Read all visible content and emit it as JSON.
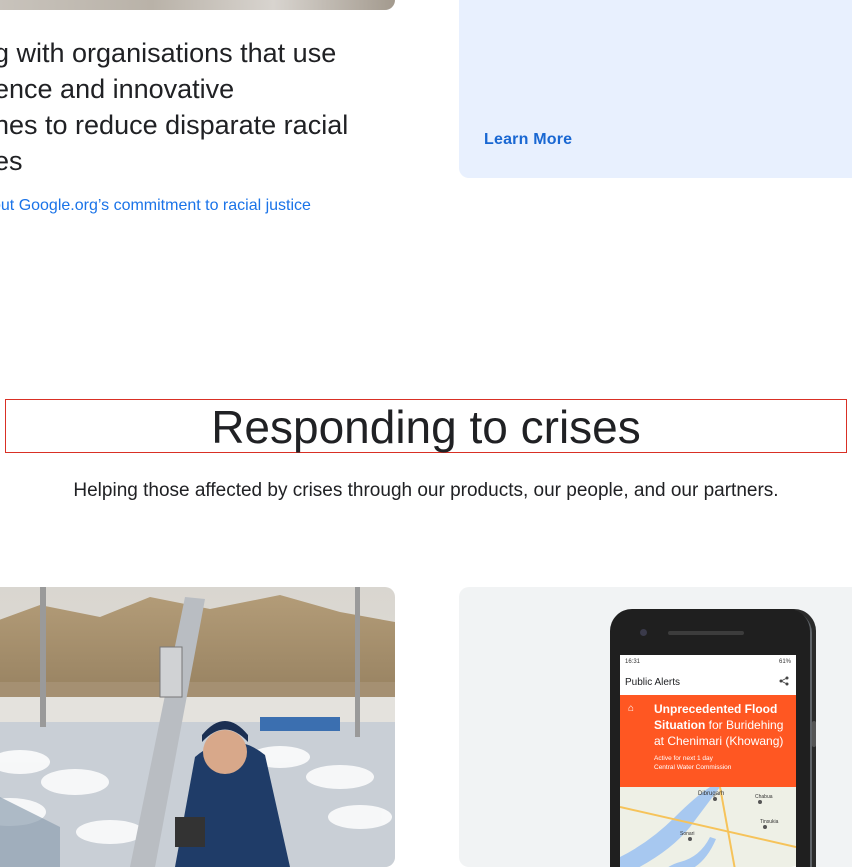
{
  "upper_section": {
    "headline_lines": [
      "g with organisations that use",
      "ence and innovative",
      "hes to reduce disparate racial",
      "es"
    ],
    "racial_justice_link": "out Google.org’s commitment to racial justice",
    "learn_more_label": "Learn More"
  },
  "crises_section": {
    "title": "Responding to crises",
    "subtitle": "Helping those affected by crises through our products, our people, and our partners."
  },
  "phone_screen": {
    "status_time": "16:31",
    "status_right": "61%",
    "app_title": "Public Alerts",
    "alert_title_bold_1": "Unprecedented Flood",
    "alert_title_bold_2": "Situation",
    "alert_title_rest_1": " for Buridehing",
    "alert_title_rest_2": "at Chenimari (Khowang)",
    "alert_duration": "Active for next 1 day",
    "alert_source": "Central Water Commission",
    "map_labels": [
      "Dibrugarh",
      "Chabua",
      "Sonari",
      "Tinsukia"
    ]
  },
  "colors": {
    "link": "#1a73e8",
    "blue_card_bg": "#e8f0fe",
    "alert_orange": "#ff5722",
    "title_outline": "#d93025"
  }
}
